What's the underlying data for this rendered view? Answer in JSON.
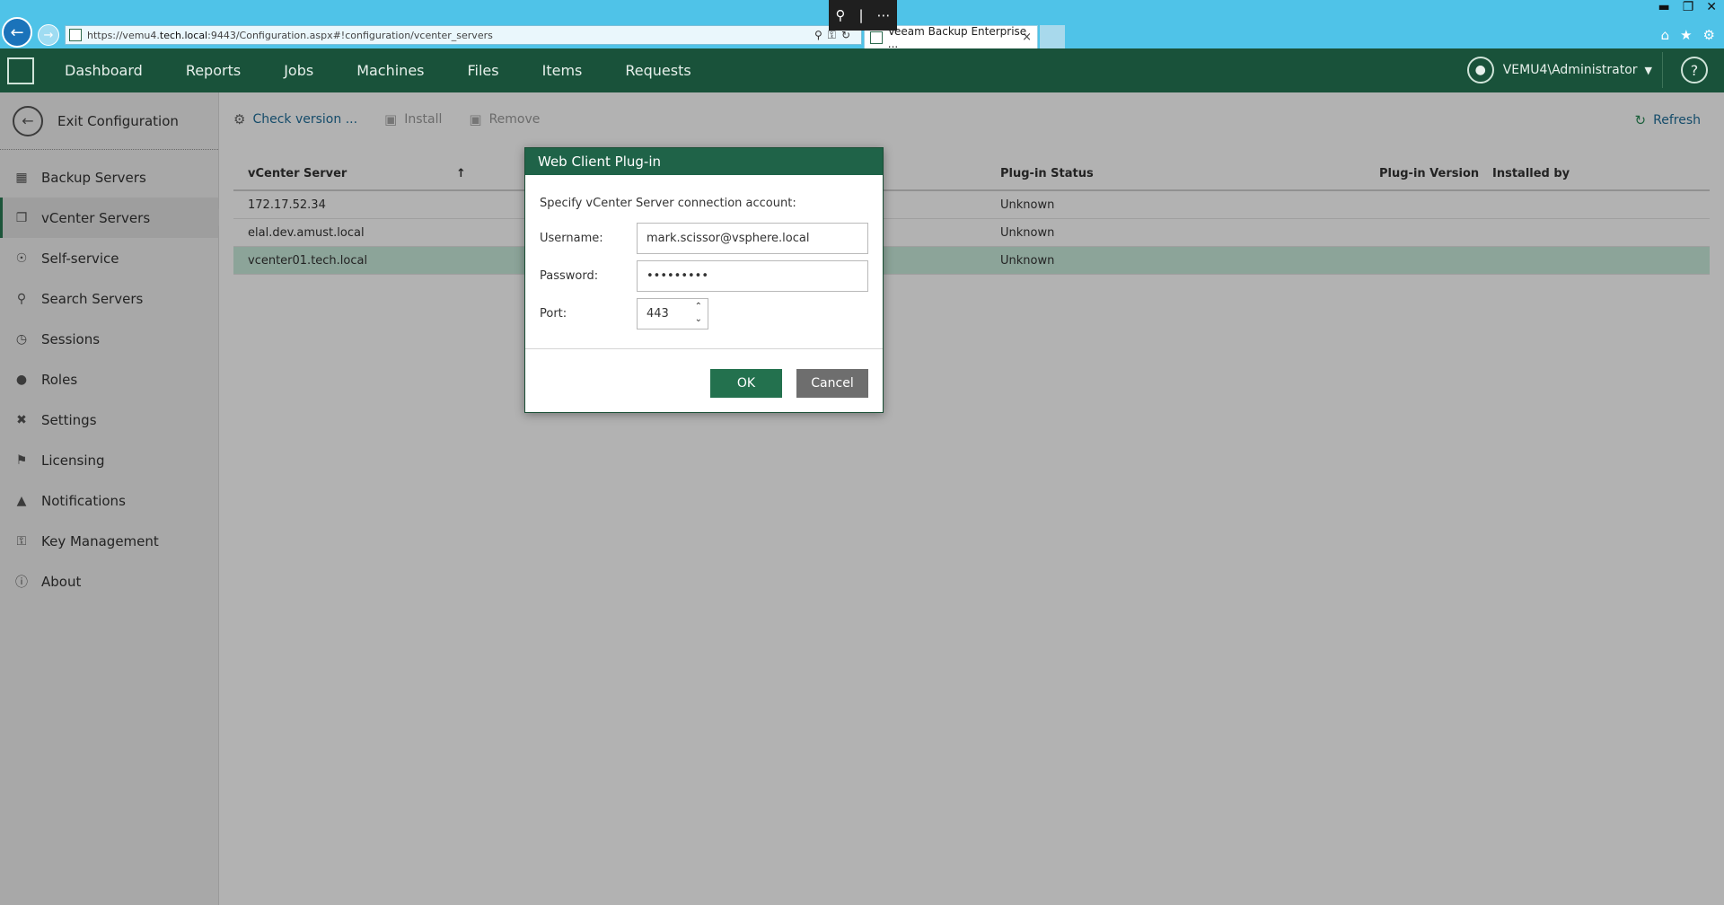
{
  "browser": {
    "url_prefix": "https://vemu4.",
    "url_host": "tech.local",
    "url_rest": ":9443/Configuration.aspx#!configuration/vcenter_servers",
    "tab_title": "Veeam Backup Enterprise ...",
    "tab_close": "×"
  },
  "header": {
    "nav": [
      "Dashboard",
      "Reports",
      "Jobs",
      "Machines",
      "Files",
      "Items",
      "Requests"
    ],
    "user": "VEMU4\\Administrator",
    "help": "?"
  },
  "sidebar": {
    "exit_label": "Exit Configuration",
    "items": [
      {
        "label": "Backup Servers",
        "icon": "server-icon"
      },
      {
        "label": "vCenter Servers",
        "icon": "vcenter-icon",
        "active": true
      },
      {
        "label": "Self-service",
        "icon": "cart-icon"
      },
      {
        "label": "Search Servers",
        "icon": "search-server-icon"
      },
      {
        "label": "Sessions",
        "icon": "clock-icon"
      },
      {
        "label": "Roles",
        "icon": "user-icon"
      },
      {
        "label": "Settings",
        "icon": "tools-icon"
      },
      {
        "label": "Licensing",
        "icon": "key-person-icon"
      },
      {
        "label": "Notifications",
        "icon": "bell-icon"
      },
      {
        "label": "Key Management",
        "icon": "key-icon"
      },
      {
        "label": "About",
        "icon": "info-icon"
      }
    ]
  },
  "toolbar": {
    "check_version": "Check version ...",
    "install": "Install",
    "remove": "Remove",
    "refresh": "Refresh"
  },
  "grid": {
    "columns": {
      "vcenter": "vCenter Server",
      "status": "Plug-in Status",
      "version": "Plug-in Version",
      "installed_by": "Installed by"
    },
    "sort_arrow": "↑",
    "rows": [
      {
        "server": "172.17.52.34",
        "status": "Unknown"
      },
      {
        "server": "elal.dev.amust.local",
        "status": "Unknown"
      },
      {
        "server": "vcenter01.tech.local",
        "status": "Unknown",
        "selected": true
      }
    ]
  },
  "dialog": {
    "title": "Web Client Plug-in",
    "intro": "Specify vCenter Server connection account:",
    "username_label": "Username:",
    "username_value": "mark.scissor@vsphere.local",
    "password_label": "Password:",
    "password_value": "•••••••••",
    "port_label": "Port:",
    "port_value": "443",
    "ok": "OK",
    "cancel": "Cancel"
  }
}
